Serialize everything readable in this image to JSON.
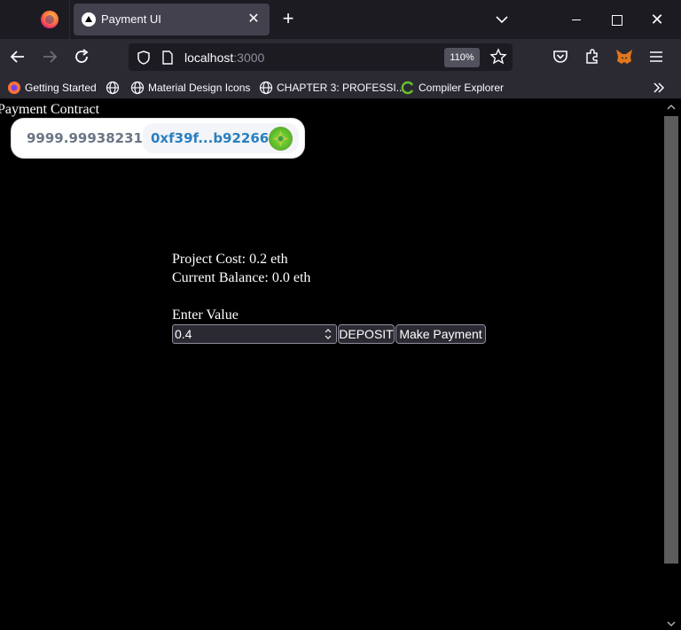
{
  "browser": {
    "tab": {
      "title": "Payment UI"
    },
    "url": {
      "host": "localhost",
      "port": ":3000"
    },
    "zoom": "110%",
    "bookmarks": [
      {
        "label": "Getting Started"
      },
      {
        "label": "Material Design Icons"
      },
      {
        "label": "CHAPTER 3: PROFESSI..."
      },
      {
        "label": "Compiler Explorer"
      }
    ]
  },
  "page": {
    "title": "Payment Contract",
    "wallet": {
      "balance": "9999.99938231",
      "address": "0xf39f...b92266"
    },
    "project_cost": "Project Cost: 0.2 eth",
    "current_balance": "Current Balance: 0.0 eth",
    "enter_value_label": "Enter Value",
    "value_input": "0.4",
    "deposit_label": "DEPOSIT",
    "make_payment_label": "Make Payment"
  },
  "colors": {
    "page_bg": "#000000",
    "chrome_bg": "#2b2a33",
    "tab_active": "#42414d",
    "address_accent": "#2a7fbf"
  }
}
